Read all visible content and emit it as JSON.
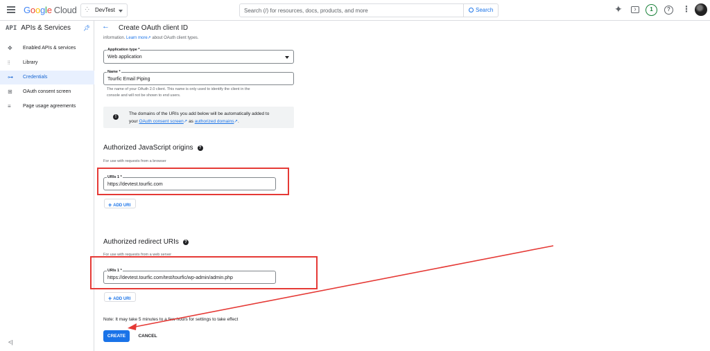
{
  "topbar": {
    "logo": {
      "g": "G",
      "o1": "o",
      "o2": "o",
      "g2": "g",
      "l": "l",
      "e": "e",
      "cloud": "Cloud"
    },
    "project": "DevTest",
    "search_placeholder": "Search (/) for resources, docs, products, and more",
    "search_button": "Search",
    "notifications_count": "1",
    "help_label": "?"
  },
  "sidebar": {
    "api_badge": "API",
    "title": "APIs & Services",
    "items": [
      {
        "label": "Enabled APIs & services",
        "icon": "hub-icon"
      },
      {
        "label": "Library",
        "icon": "library-icon"
      },
      {
        "label": "Credentials",
        "icon": "key-icon",
        "active": true
      },
      {
        "label": "OAuth consent screen",
        "icon": "consent-icon"
      },
      {
        "label": "Page usage agreements",
        "icon": "agreements-icon"
      }
    ],
    "collapse_label": "<|"
  },
  "page": {
    "title": "Create OAuth client ID"
  },
  "form": {
    "intro_prefix": "information.",
    "intro_link": "Learn more",
    "intro_suffix": "about OAuth client types.",
    "app_type_label": "Application type *",
    "app_type_value": "Web application",
    "name_label": "Name *",
    "name_value": "Tourfic Email Piping",
    "name_hint_1": "The name of your OAuth 2.0 client. This name is only used to identify the client in the",
    "name_hint_2": "console and will not be shown to end users.",
    "info_text_1": "The domains of the URIs you add below will be automatically added to",
    "info_text_2a": "your",
    "info_link_1": "OAuth consent screen",
    "info_text_2b": "as",
    "info_link_2": "authorized domains",
    "info_text_2c": ".",
    "js_origins_title": "Authorized JavaScript origins",
    "js_origins_sub": "For use with requests from a browser",
    "js_uri_label": "URIs 1 *",
    "js_uri_value": "https://devtest.tourfic.com",
    "add_uri": "ADD URI",
    "redirect_title": "Authorized redirect URIs",
    "redirect_sub": "For use with requests from a web server",
    "redirect_uri_label": "URIs 1 *",
    "redirect_uri_value": "https://devtest.tourfic.com/test/tourfic/wp-admin/admin.php",
    "note": "Note: It may take 5 minutes to a few hours for settings to take effect",
    "create": "CREATE",
    "cancel": "CANCEL"
  },
  "annotation_color": "#e53935"
}
